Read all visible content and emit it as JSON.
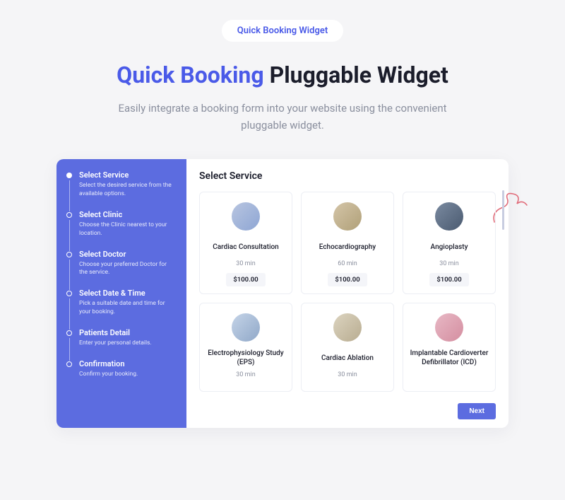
{
  "badge": "Quick Booking Widget",
  "headline": {
    "accent": "Quick Booking",
    "rest": " Pluggable Widget"
  },
  "subhead": "Easily integrate a booking form into your website using the convenient pluggable widget.",
  "sidebar": {
    "steps": [
      {
        "title": "Select Service",
        "desc": "Select the desired service from the available options."
      },
      {
        "title": "Select Clinic",
        "desc": "Choose the Clinic nearest to your location."
      },
      {
        "title": "Select Doctor",
        "desc": "Choose your preferred Doctor for the service."
      },
      {
        "title": "Select Date & Time",
        "desc": "Pick a suitable date and time for your booking."
      },
      {
        "title": "Patients Detail",
        "desc": "Enter your personal details."
      },
      {
        "title": "Confirmation",
        "desc": "Confirm your booking."
      }
    ]
  },
  "main": {
    "title": "Select Service",
    "services": [
      {
        "name": "Cardiac Consultation",
        "duration": "30 min",
        "price": "$100.00"
      },
      {
        "name": "Echocardiography",
        "duration": "60 min",
        "price": "$100.00"
      },
      {
        "name": "Angioplasty",
        "duration": "30 min",
        "price": "$100.00"
      },
      {
        "name": "Electrophysiology Study (EPS)",
        "duration": "30 min",
        "price": ""
      },
      {
        "name": "Cardiac Ablation",
        "duration": "30 min",
        "price": ""
      },
      {
        "name": "Implantable Cardioverter Defibrillator (ICD)",
        "duration": "",
        "price": ""
      }
    ],
    "next": "Next"
  }
}
